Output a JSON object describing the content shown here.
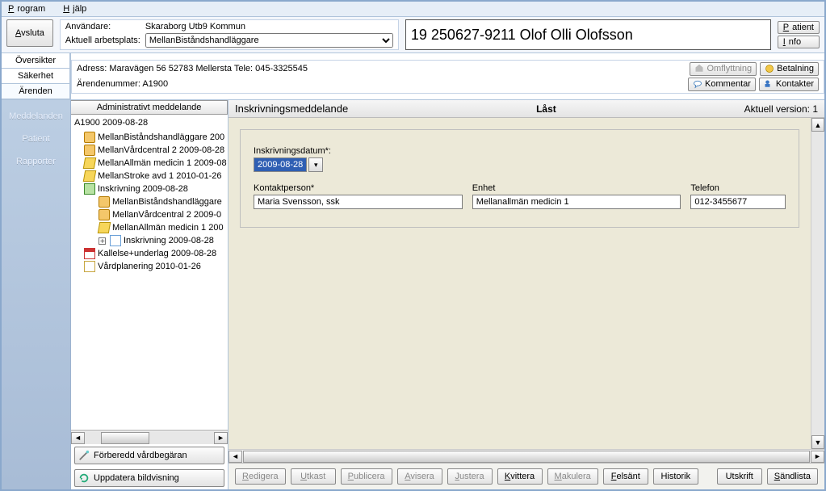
{
  "menu": {
    "program": "Program",
    "help": "Hjälp"
  },
  "toolbar": {
    "exit": "Avsluta",
    "user_label": "Användare:",
    "user_value": "Skaraborg Utb9 Kommun",
    "workplace_label": "Aktuell arbetsplats:",
    "workplace_value": "MellanBiståndshandläggare",
    "patient": "Patient",
    "info": "Info"
  },
  "patient_banner": "19 250627-9211 Olof Olli Olofsson",
  "left_tabs": [
    "Översikter",
    "Säkerhet",
    "Ärenden"
  ],
  "address": {
    "line1": "Adress: Maravägen 56  52783 Mellersta  Tele: 045-3325545",
    "line2": "Ärendenummer: A1900",
    "btn_move": "Omflyttning",
    "btn_pay": "Betalning",
    "btn_comment": "Kommentar",
    "btn_contacts": "Kontakter"
  },
  "sidenav": [
    "Meddelanden",
    "Patient",
    "Rapporter"
  ],
  "center": {
    "header": "Administrativt meddelande",
    "btn_prepare": "Förberedd vårdbegäran",
    "btn_update": "Uppdatera bildvisning"
  },
  "tree": {
    "root": "A1900 2009-08-28",
    "items": [
      {
        "d": 1,
        "icon": "person",
        "label": "MellanBiståndshandläggare 200"
      },
      {
        "d": 1,
        "icon": "person",
        "label": "MellanVårdcentral 2 2009-08-28"
      },
      {
        "d": 1,
        "icon": "key",
        "label": "MellanAllmän medicin 1 2009-08"
      },
      {
        "d": 1,
        "icon": "key",
        "label": "MellanStroke avd 1 2010-01-26"
      },
      {
        "d": 1,
        "icon": "house",
        "label": "Inskrivning 2009-08-28"
      },
      {
        "d": 2,
        "icon": "person",
        "label": "MellanBiståndshandläggare"
      },
      {
        "d": 2,
        "icon": "person",
        "label": "MellanVårdcentral 2 2009-0"
      },
      {
        "d": 2,
        "icon": "key",
        "label": "MellanAllmän medicin 1 200"
      },
      {
        "d": 2,
        "icon": "page",
        "label": "Inskrivning 2009-08-28",
        "expand": true
      },
      {
        "d": 1,
        "icon": "cal",
        "label": "Kallelse+underlag 2009-08-28"
      },
      {
        "d": 1,
        "icon": "doc",
        "label": "Vårdplanering 2010-01-26"
      }
    ]
  },
  "form_header": {
    "title": "Inskrivningsmeddelande",
    "status": "Låst",
    "version": "Aktuell version: 1"
  },
  "form": {
    "date_label": "Inskrivningsdatum*:",
    "date_value": "2009-08-28",
    "contact_label": "Kontaktperson*",
    "contact_value": "Maria Svensson, ssk",
    "unit_label": "Enhet",
    "unit_value": "Mellanallmän medicin 1",
    "phone_label": "Telefon",
    "phone_value": "012-3455677"
  },
  "actions": {
    "redigera": "Redigera",
    "utkast": "Utkast",
    "publicera": "Publicera",
    "avisera": "Avisera",
    "justera": "Justera",
    "kvittera": "Kvittera",
    "makulera": "Makulera",
    "felsant": "Felsänt",
    "historik": "Historik",
    "utskrift": "Utskrift",
    "sandlista": "Sändlista"
  }
}
